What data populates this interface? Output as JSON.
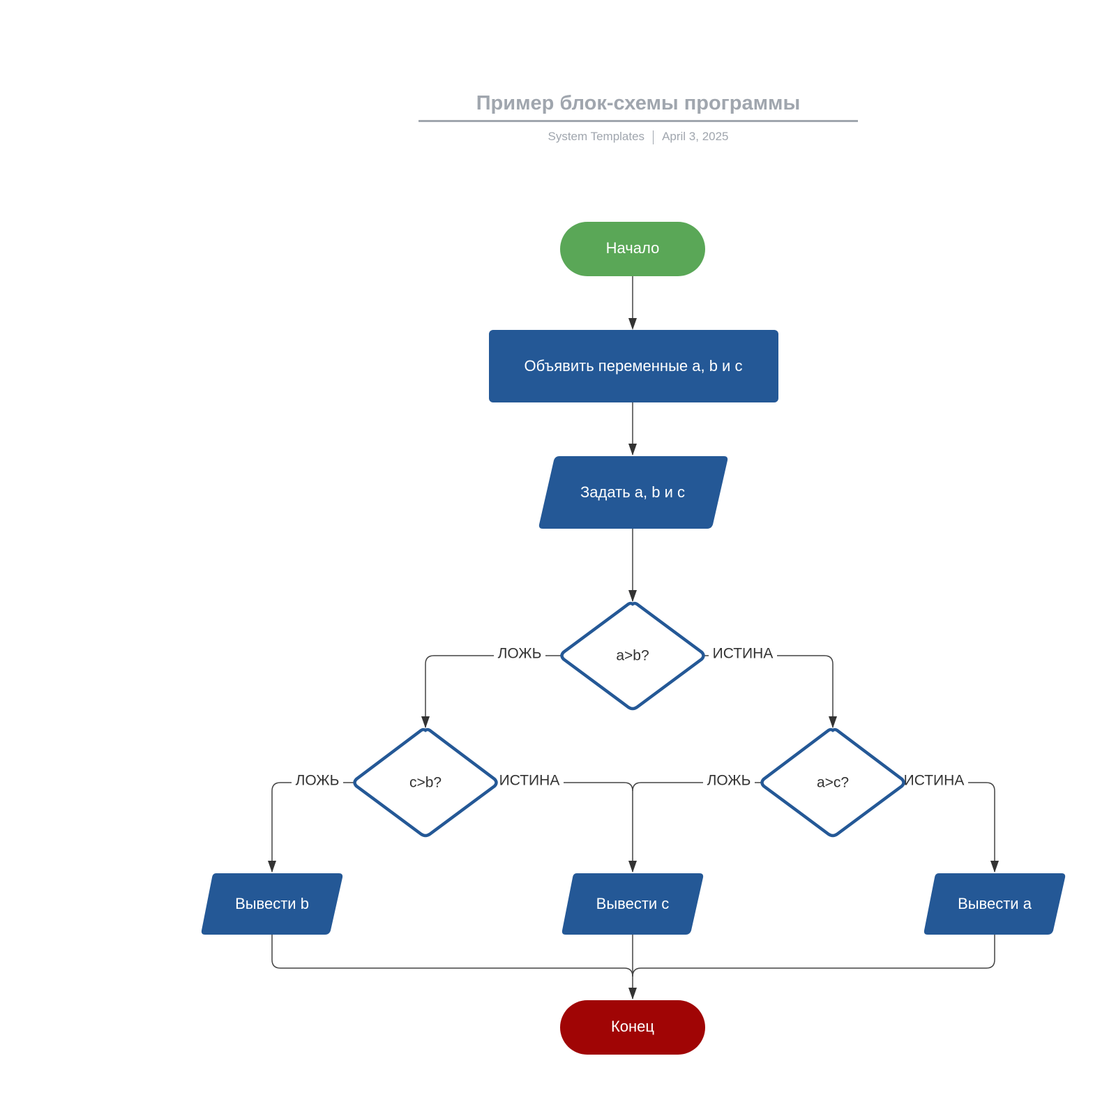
{
  "header": {
    "title": "Пример блок-схемы программы",
    "author": "System Templates",
    "date": "April 3, 2025"
  },
  "colors": {
    "start": "#5aa757",
    "process": "#245896",
    "end": "#a00505",
    "decision_stroke": "#245896",
    "edge": "#444444"
  },
  "nodes": {
    "start": "Начало",
    "declare": "Объявить переменные a, b и c",
    "input": "Задать a, b и c",
    "dec_ab": "a>b?",
    "dec_cb": "c>b?",
    "dec_ac": "a>c?",
    "out_b": "Вывести b",
    "out_c": "Вывести c",
    "out_a": "Вывести a",
    "end": "Конец"
  },
  "edges": {
    "false_label": "ЛОЖЬ",
    "true_label": "ИСТИНА"
  }
}
